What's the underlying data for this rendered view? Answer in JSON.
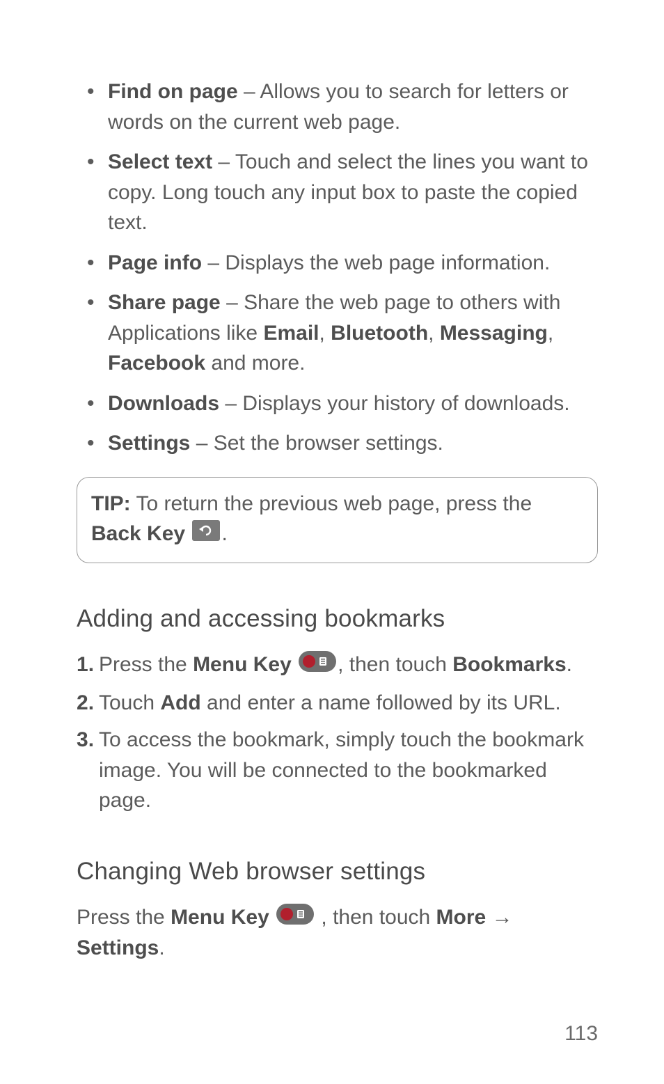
{
  "bullets": [
    {
      "term": "Find on page",
      "desc": " – Allows you to search for letters or words on the current web page."
    },
    {
      "term": "Select text",
      "desc": " – Touch and select the lines you want to copy. Long touch any input box to paste the copied text."
    },
    {
      "term": "Page info",
      "desc": " – Displays the web page information."
    },
    {
      "term": "Share page",
      "pre": " – Share the web page to others with Applications like ",
      "apps": [
        "Email",
        "Bluetooth",
        "Messaging",
        "Facebook"
      ],
      "post": " and more."
    },
    {
      "term": "Downloads",
      "desc": " – Displays your history of downloads."
    },
    {
      "term": "Settings",
      "desc": " – Set the browser settings."
    }
  ],
  "tip": {
    "label": "TIP:",
    "text": " To return the previous web page, press the ",
    "key": "Back Key ",
    "end": "."
  },
  "section1": {
    "heading": "Adding and accessing bookmarks",
    "steps": [
      {
        "pre": "Press the ",
        "key": "Menu Key ",
        "mid": ", then touch ",
        "target": "Bookmarks",
        "post": "."
      },
      {
        "pre": "Touch ",
        "key": "Add",
        "post": " and enter a name followed by its URL."
      },
      {
        "text": "To access the bookmark, simply touch the bookmark image. You will be connected to the bookmarked page."
      }
    ]
  },
  "section2": {
    "heading": "Changing Web browser settings",
    "line": {
      "pre": "Press the ",
      "key": "Menu Key ",
      "mid": " , then touch ",
      "more": "More",
      "arrow": " → ",
      "settings": "Settings",
      "post": "."
    }
  },
  "pagenum": "113"
}
